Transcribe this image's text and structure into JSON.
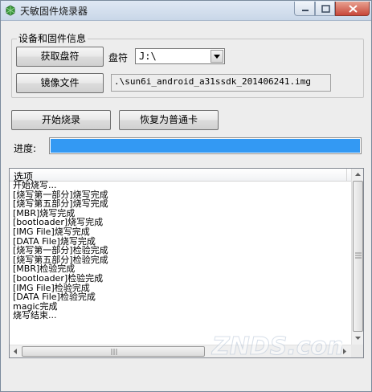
{
  "window": {
    "title": "天敏固件烧录器",
    "controls": [
      "minimize",
      "maximize",
      "close"
    ]
  },
  "group": {
    "label": "设备和固件信息",
    "get_drive_button": "获取盘符",
    "drive_label": "盘符",
    "drive_value": "J:\\",
    "image_file_button": "镜像文件",
    "image_path": ".\\sun6i_android_a31ssdk_201406241.img"
  },
  "actions": {
    "start_burn_button": "开始烧录",
    "restore_button": "恢复为普通卡"
  },
  "progress": {
    "label": "进度:",
    "fraction": 1.0,
    "color": "#3399f3"
  },
  "log": {
    "column_header": "选项",
    "lines": [
      "开始烧写...",
      "[烧写第一部分]烧写完成",
      "[烧写第五部分]烧写完成",
      "[MBR]烧写完成",
      "[bootloader]烧写完成",
      "[IMG File]烧写完成",
      "[DATA File]烧写完成",
      "[烧写第一部分]检验完成",
      "[烧写第五部分]检验完成",
      "[MBR]检验完成",
      "[bootloader]检验完成",
      "[IMG File]检验完成",
      "[DATA File]检验完成",
      "magic完成",
      "烧写结束..."
    ]
  },
  "watermark": {
    "text": "ZNDS.com"
  }
}
